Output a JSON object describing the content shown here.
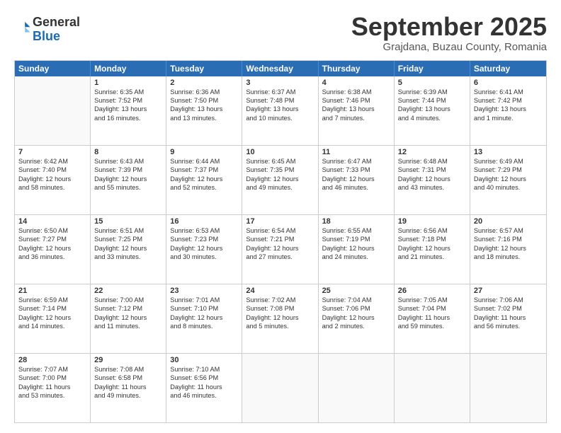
{
  "logo": {
    "line1": "General",
    "line2": "Blue",
    "icon_color": "#1a6ab5"
  },
  "title": "September 2025",
  "location": "Grajdana, Buzau County, Romania",
  "header_days": [
    "Sunday",
    "Monday",
    "Tuesday",
    "Wednesday",
    "Thursday",
    "Friday",
    "Saturday"
  ],
  "weeks": [
    [
      {
        "day": "",
        "lines": []
      },
      {
        "day": "1",
        "lines": [
          "Sunrise: 6:35 AM",
          "Sunset: 7:52 PM",
          "Daylight: 13 hours",
          "and 16 minutes."
        ]
      },
      {
        "day": "2",
        "lines": [
          "Sunrise: 6:36 AM",
          "Sunset: 7:50 PM",
          "Daylight: 13 hours",
          "and 13 minutes."
        ]
      },
      {
        "day": "3",
        "lines": [
          "Sunrise: 6:37 AM",
          "Sunset: 7:48 PM",
          "Daylight: 13 hours",
          "and 10 minutes."
        ]
      },
      {
        "day": "4",
        "lines": [
          "Sunrise: 6:38 AM",
          "Sunset: 7:46 PM",
          "Daylight: 13 hours",
          "and 7 minutes."
        ]
      },
      {
        "day": "5",
        "lines": [
          "Sunrise: 6:39 AM",
          "Sunset: 7:44 PM",
          "Daylight: 13 hours",
          "and 4 minutes."
        ]
      },
      {
        "day": "6",
        "lines": [
          "Sunrise: 6:41 AM",
          "Sunset: 7:42 PM",
          "Daylight: 13 hours",
          "and 1 minute."
        ]
      }
    ],
    [
      {
        "day": "7",
        "lines": [
          "Sunrise: 6:42 AM",
          "Sunset: 7:40 PM",
          "Daylight: 12 hours",
          "and 58 minutes."
        ]
      },
      {
        "day": "8",
        "lines": [
          "Sunrise: 6:43 AM",
          "Sunset: 7:39 PM",
          "Daylight: 12 hours",
          "and 55 minutes."
        ]
      },
      {
        "day": "9",
        "lines": [
          "Sunrise: 6:44 AM",
          "Sunset: 7:37 PM",
          "Daylight: 12 hours",
          "and 52 minutes."
        ]
      },
      {
        "day": "10",
        "lines": [
          "Sunrise: 6:45 AM",
          "Sunset: 7:35 PM",
          "Daylight: 12 hours",
          "and 49 minutes."
        ]
      },
      {
        "day": "11",
        "lines": [
          "Sunrise: 6:47 AM",
          "Sunset: 7:33 PM",
          "Daylight: 12 hours",
          "and 46 minutes."
        ]
      },
      {
        "day": "12",
        "lines": [
          "Sunrise: 6:48 AM",
          "Sunset: 7:31 PM",
          "Daylight: 12 hours",
          "and 43 minutes."
        ]
      },
      {
        "day": "13",
        "lines": [
          "Sunrise: 6:49 AM",
          "Sunset: 7:29 PM",
          "Daylight: 12 hours",
          "and 40 minutes."
        ]
      }
    ],
    [
      {
        "day": "14",
        "lines": [
          "Sunrise: 6:50 AM",
          "Sunset: 7:27 PM",
          "Daylight: 12 hours",
          "and 36 minutes."
        ]
      },
      {
        "day": "15",
        "lines": [
          "Sunrise: 6:51 AM",
          "Sunset: 7:25 PM",
          "Daylight: 12 hours",
          "and 33 minutes."
        ]
      },
      {
        "day": "16",
        "lines": [
          "Sunrise: 6:53 AM",
          "Sunset: 7:23 PM",
          "Daylight: 12 hours",
          "and 30 minutes."
        ]
      },
      {
        "day": "17",
        "lines": [
          "Sunrise: 6:54 AM",
          "Sunset: 7:21 PM",
          "Daylight: 12 hours",
          "and 27 minutes."
        ]
      },
      {
        "day": "18",
        "lines": [
          "Sunrise: 6:55 AM",
          "Sunset: 7:19 PM",
          "Daylight: 12 hours",
          "and 24 minutes."
        ]
      },
      {
        "day": "19",
        "lines": [
          "Sunrise: 6:56 AM",
          "Sunset: 7:18 PM",
          "Daylight: 12 hours",
          "and 21 minutes."
        ]
      },
      {
        "day": "20",
        "lines": [
          "Sunrise: 6:57 AM",
          "Sunset: 7:16 PM",
          "Daylight: 12 hours",
          "and 18 minutes."
        ]
      }
    ],
    [
      {
        "day": "21",
        "lines": [
          "Sunrise: 6:59 AM",
          "Sunset: 7:14 PM",
          "Daylight: 12 hours",
          "and 14 minutes."
        ]
      },
      {
        "day": "22",
        "lines": [
          "Sunrise: 7:00 AM",
          "Sunset: 7:12 PM",
          "Daylight: 12 hours",
          "and 11 minutes."
        ]
      },
      {
        "day": "23",
        "lines": [
          "Sunrise: 7:01 AM",
          "Sunset: 7:10 PM",
          "Daylight: 12 hours",
          "and 8 minutes."
        ]
      },
      {
        "day": "24",
        "lines": [
          "Sunrise: 7:02 AM",
          "Sunset: 7:08 PM",
          "Daylight: 12 hours",
          "and 5 minutes."
        ]
      },
      {
        "day": "25",
        "lines": [
          "Sunrise: 7:04 AM",
          "Sunset: 7:06 PM",
          "Daylight: 12 hours",
          "and 2 minutes."
        ]
      },
      {
        "day": "26",
        "lines": [
          "Sunrise: 7:05 AM",
          "Sunset: 7:04 PM",
          "Daylight: 11 hours",
          "and 59 minutes."
        ]
      },
      {
        "day": "27",
        "lines": [
          "Sunrise: 7:06 AM",
          "Sunset: 7:02 PM",
          "Daylight: 11 hours",
          "and 56 minutes."
        ]
      }
    ],
    [
      {
        "day": "28",
        "lines": [
          "Sunrise: 7:07 AM",
          "Sunset: 7:00 PM",
          "Daylight: 11 hours",
          "and 53 minutes."
        ]
      },
      {
        "day": "29",
        "lines": [
          "Sunrise: 7:08 AM",
          "Sunset: 6:58 PM",
          "Daylight: 11 hours",
          "and 49 minutes."
        ]
      },
      {
        "day": "30",
        "lines": [
          "Sunrise: 7:10 AM",
          "Sunset: 6:56 PM",
          "Daylight: 11 hours",
          "and 46 minutes."
        ]
      },
      {
        "day": "",
        "lines": []
      },
      {
        "day": "",
        "lines": []
      },
      {
        "day": "",
        "lines": []
      },
      {
        "day": "",
        "lines": []
      }
    ]
  ]
}
